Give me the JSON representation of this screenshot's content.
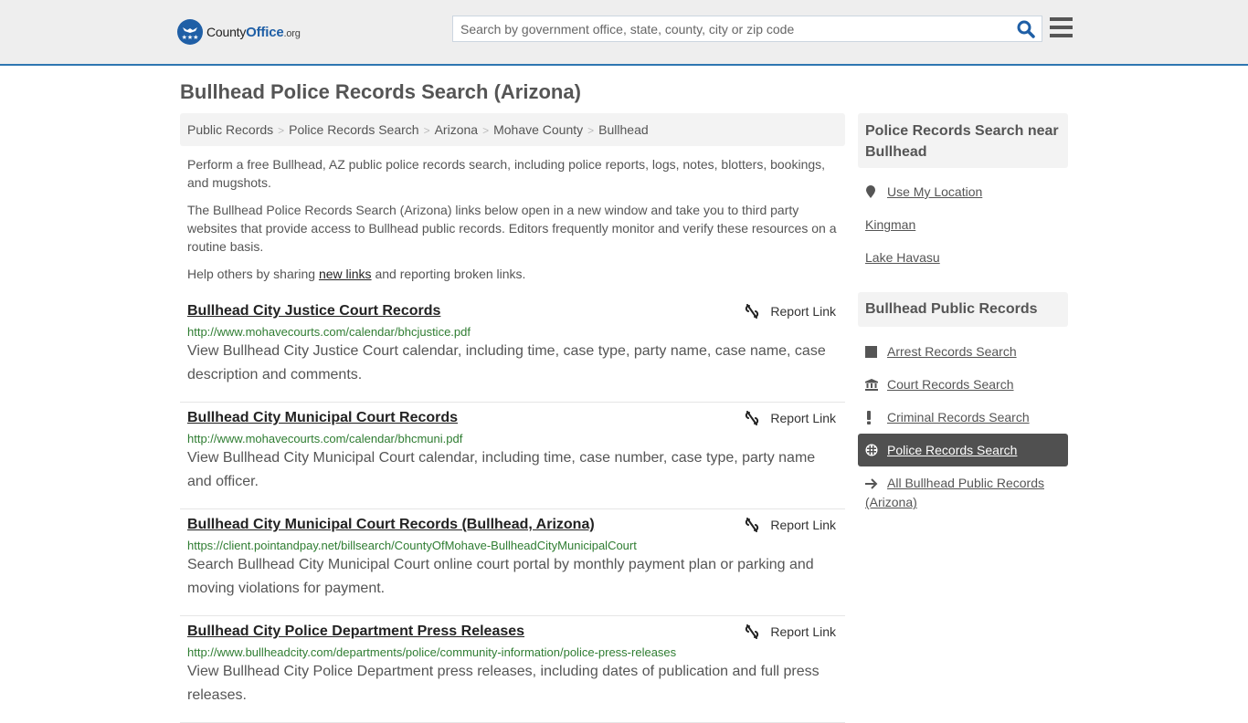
{
  "header": {
    "logo": {
      "brand_main": "County",
      "brand_accent": "Office",
      "brand_suffix": ".org"
    },
    "search": {
      "placeholder": "Search by government office, state, county, city or zip code",
      "value": ""
    },
    "icons": {
      "search": "search-icon",
      "menu": "hamburger-menu-icon"
    }
  },
  "page": {
    "title": "Bullhead Police Records Search (Arizona)"
  },
  "breadcrumb": [
    {
      "label": "Public Records"
    },
    {
      "label": "Police Records Search"
    },
    {
      "label": "Arizona"
    },
    {
      "label": "Mohave County"
    },
    {
      "label": "Bullhead"
    }
  ],
  "intro": {
    "p1": "Perform a free Bullhead, AZ public police records search, including police reports, logs, notes, blotters, bookings, and mugshots.",
    "p2": "The Bullhead Police Records Search (Arizona) links below open in a new window and take you to third party websites that provide access to Bullhead public records. Editors frequently monitor and verify these resources on a routine basis.",
    "p3_before": "Help others by sharing ",
    "p3_link": "new links",
    "p3_after": " and reporting broken links."
  },
  "results": [
    {
      "title": "Bullhead City Justice Court Records",
      "url": "http://www.mohavecourts.com/calendar/bhcjustice.pdf",
      "description": "View Bullhead City Justice Court calendar, including time, case type, party name, case name, case description and comments.",
      "report_label": "Report Link"
    },
    {
      "title": "Bullhead City Municipal Court Records",
      "url": "http://www.mohavecourts.com/calendar/bhcmuni.pdf",
      "description": "View Bullhead City Municipal Court calendar, including time, case number, case type, party name and officer.",
      "report_label": "Report Link"
    },
    {
      "title": "Bullhead City Municipal Court Records (Bullhead, Arizona)",
      "url": "https://client.pointandpay.net/billsearch/CountyOfMohave-BullheadCityMunicipalCourt",
      "description": "Search Bullhead City Municipal Court online court portal by monthly payment plan or parking and moving violations for payment.",
      "report_label": "Report Link"
    },
    {
      "title": "Bullhead City Police Department Press Releases",
      "url": "http://www.bullheadcity.com/departments/police/community-information/police-press-releases",
      "description": "View Bullhead City Police Department press releases, including dates of publication and full press releases.",
      "report_label": "Report Link"
    }
  ],
  "sidebar": {
    "nearby": {
      "heading": "Police Records Search near Bullhead",
      "use_location": "Use My Location",
      "items": [
        {
          "label": "Kingman"
        },
        {
          "label": "Lake Havasu"
        }
      ]
    },
    "public_records": {
      "heading": "Bullhead Public Records",
      "items": [
        {
          "label": "Arrest Records Search",
          "icon": "square-icon",
          "active": false
        },
        {
          "label": "Court Records Search",
          "icon": "courthouse-icon",
          "active": false
        },
        {
          "label": "Criminal Records Search",
          "icon": "exclamation-icon",
          "active": false
        },
        {
          "label": "Police Records Search",
          "icon": "crosshair-icon",
          "active": true
        },
        {
          "label": "All Bullhead Public Records (Arizona)",
          "icon": "arrow-right-icon",
          "active": false
        }
      ]
    }
  },
  "colors": {
    "accent_blue": "#1f5fa6",
    "header_border": "#2e76b1",
    "url_green": "#2f7d32",
    "active_item_bg": "#505050"
  }
}
